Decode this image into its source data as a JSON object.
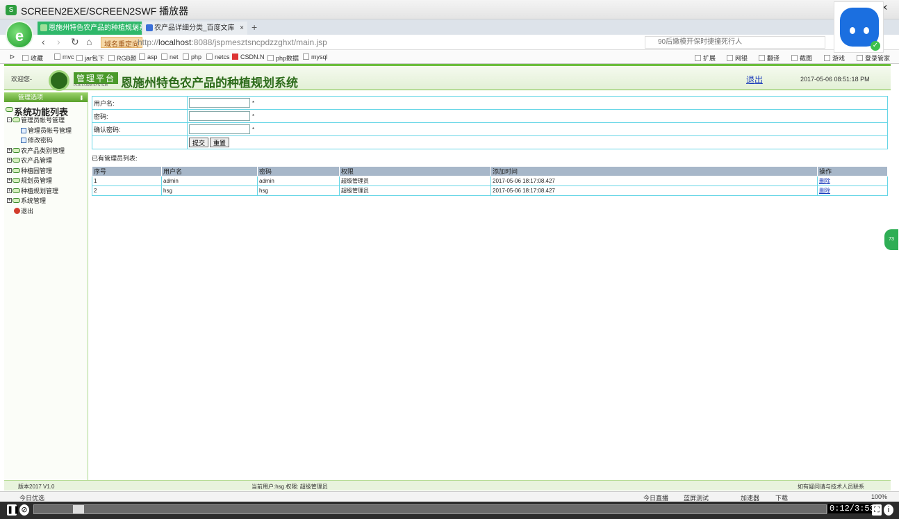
{
  "window": {
    "title": "SCREEN2EXE/SCREEN2SWF 播放器",
    "minimize": "—",
    "maximize": "□",
    "close": "✕"
  },
  "tabs": [
    {
      "label": "恩施州特色农产品的种植规划系统",
      "close": "×"
    },
    {
      "label": "农产品详细分类_百度文库",
      "close": "×"
    }
  ],
  "new_tab": "+",
  "nav": {
    "back": "‹",
    "forward": "›",
    "reload": "↻",
    "home": "⌂",
    "redirect_badge": "域名重定向",
    "url_prefix": "http://",
    "url_host": "localhost",
    "url_rest": ":8088/jspmesztsncpdzzghxt/main.jsp",
    "search_text": "90后嫩模开保时捷撞死行人"
  },
  "bookmarks": [
    "收藏",
    "mvc",
    "jar包下",
    "RGB颜",
    "asp",
    "net",
    "php",
    "netcs",
    "CSDN.N",
    "php数据",
    "mysql"
  ],
  "bookmarks_right": [
    "扩展",
    "网银",
    "翻译",
    "截图",
    "游戏",
    "登录管家"
  ],
  "header": {
    "welcome": "欢迎您-",
    "badge": "管理平台",
    "badge_sub": "PLATFORM SYSTEM",
    "system_name": "恩施州特色农产品的种植规划系统",
    "logout": "退出",
    "datetime": "2017-05-06 08:51:18 PM"
  },
  "sidebar": {
    "title": "管理选项",
    "root": "系统功能列表",
    "items": [
      {
        "label": "管理员帐号管理",
        "type": "node"
      },
      {
        "label": "管理员帐号管理",
        "type": "leaf"
      },
      {
        "label": "修改密码",
        "type": "leaf"
      },
      {
        "label": "农产品类别管理",
        "type": "node"
      },
      {
        "label": "农产品管理",
        "type": "node"
      },
      {
        "label": "种植园管理",
        "type": "node"
      },
      {
        "label": "规划员管理",
        "type": "node"
      },
      {
        "label": "种植规划管理",
        "type": "node"
      },
      {
        "label": "系统管理",
        "type": "node"
      },
      {
        "label": "退出",
        "type": "exit"
      }
    ]
  },
  "form": {
    "username_label": "用户名:",
    "password_label": "密码:",
    "confirm_label": "确认密码:",
    "username_value": "",
    "required_mark": "*",
    "submit": "提交",
    "reset": "重置"
  },
  "list": {
    "title": "已有管理员列表:",
    "columns": [
      "序号",
      "用户名",
      "密码",
      "权限",
      "添加时间",
      "操作"
    ],
    "rows": [
      {
        "no": "1",
        "user": "admin",
        "pwd": "admin",
        "role": "超级管理员",
        "time": "2017-05-06 18:17:08.427",
        "action": "删除"
      },
      {
        "no": "2",
        "user": "hsg",
        "pwd": "hsg",
        "role": "超级管理员",
        "time": "2017-05-06 18:17:08.427",
        "action": "删除"
      }
    ]
  },
  "statusbar": {
    "version": "版本2017 V1.0",
    "current_user": "当前用户:hsg 权限: 超级管理员",
    "contact": "如有疑问请与技术人员联系"
  },
  "browser_status": {
    "left": "今日优选",
    "live": "今日直播",
    "tool": "蓝屏测试",
    "speed": "加速器",
    "download": "下载",
    "zoom": "100%"
  },
  "player": {
    "time": "0:12/3:53",
    "progress": 0.05
  },
  "side_widget": "73"
}
